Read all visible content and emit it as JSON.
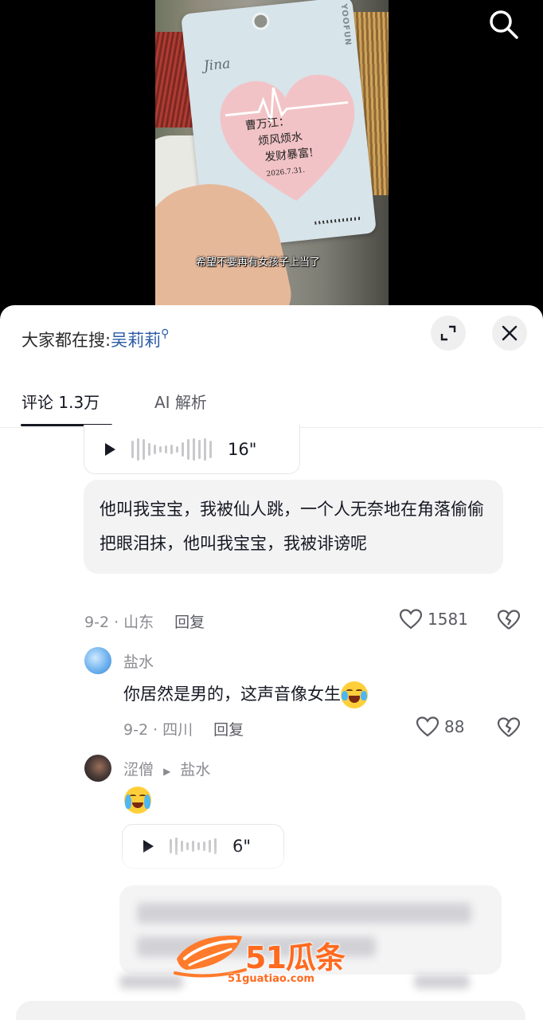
{
  "video": {
    "card_brand": "YOOFUN",
    "card_signature": "Jina",
    "note_line1": "曹万江：",
    "note_line2": "烦风烦水",
    "note_line3": "发财暴富!",
    "note_date": "2026.7.31.",
    "subtitle": "希望不要再有女孩子上当了",
    "search_icon": "search-icon"
  },
  "header": {
    "hot_prefix": "大家都在搜:",
    "hot_keyword": "吴莉莉",
    "expand_icon": "expand-icon",
    "close_icon": "close-icon"
  },
  "tabs": [
    {
      "label": "评论 1.3万",
      "active": true
    },
    {
      "label": "AI 解析",
      "active": false
    }
  ],
  "comments": [
    {
      "voice_duration": "16\"",
      "text": "他叫我宝宝，我被仙人跳，一个人无奈地在角落偷偷把眼泪抹，他叫我宝宝，我被诽谤呢",
      "date_loc": "9-2 · 山东",
      "reply": "回复",
      "likes": "1581"
    }
  ],
  "replies": [
    {
      "user": "盐水",
      "text": "你居然是男的，这声音像女生",
      "emoji": "laughing-tears-emoji",
      "date_loc": "9-2 · 四川",
      "reply": "回复",
      "likes": "88"
    },
    {
      "user": "涩僧",
      "reply_to": "盐水",
      "emoji": "crying-emoji",
      "voice_duration": "6\""
    }
  ],
  "watermark": {
    "text": "51瓜条",
    "url": "51guatiao.com"
  },
  "colors": {
    "keyword": "#2a5ca8",
    "watermark": "#ff6a1f"
  }
}
